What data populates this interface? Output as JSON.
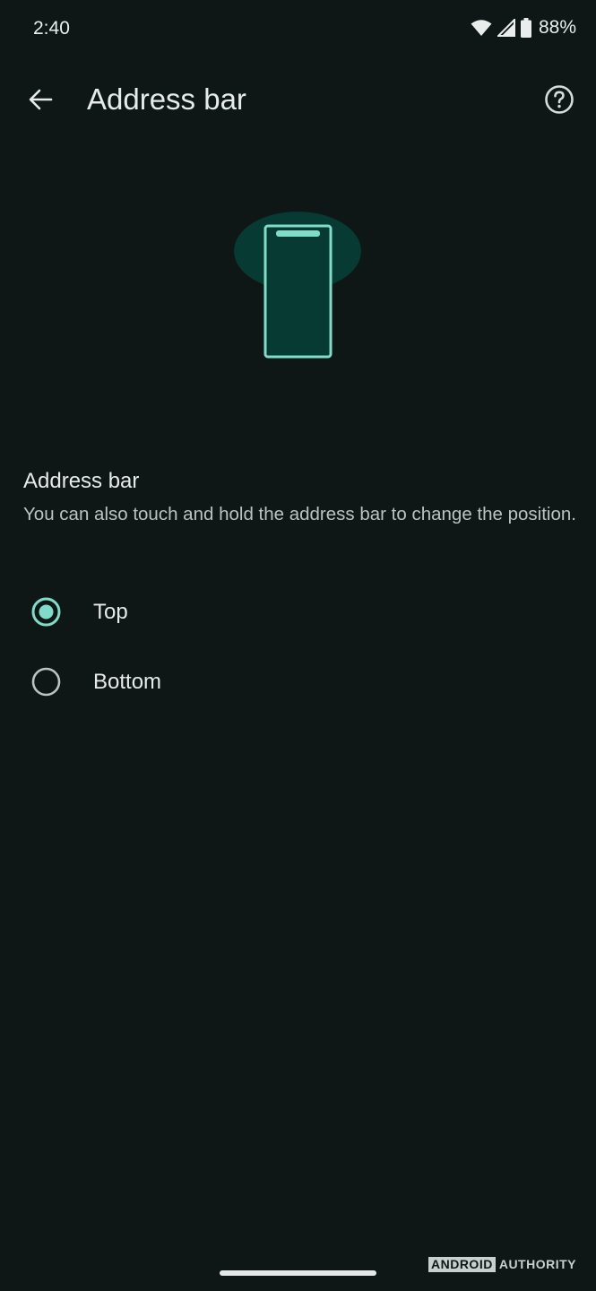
{
  "status_bar": {
    "time": "2:40",
    "battery_percent": "88%",
    "icons": [
      "wifi-icon",
      "cell-signal-icon",
      "battery-icon"
    ]
  },
  "app_bar": {
    "title": "Address bar",
    "back_icon": "arrow-back-icon",
    "help_icon": "help-circle-icon"
  },
  "illustration": {
    "icon": "phone-address-bar-top-illustration"
  },
  "section": {
    "title": "Address bar",
    "description": "You can also touch and hold the address bar to change the position."
  },
  "options": [
    {
      "label": "Top",
      "selected": true
    },
    {
      "label": "Bottom",
      "selected": false
    }
  ],
  "watermark": {
    "box_text": "ANDROID",
    "text": "AUTHORITY"
  },
  "colors": {
    "background": "#0f1716",
    "accent": "#7fdcc8",
    "illustration_fill": "#063a32",
    "text_primary": "#e6ebe9",
    "text_secondary": "#b9c3c0"
  }
}
